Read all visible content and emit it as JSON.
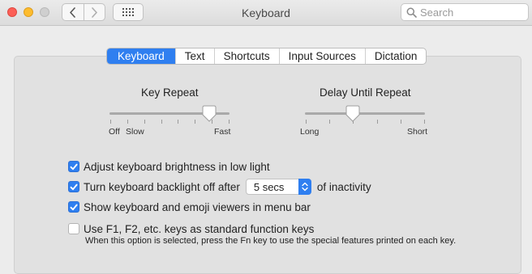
{
  "window": {
    "title": "Keyboard"
  },
  "search": {
    "placeholder": "Search"
  },
  "tabs": [
    {
      "label": "Keyboard",
      "active": true
    },
    {
      "label": "Text",
      "active": false
    },
    {
      "label": "Shortcuts",
      "active": false
    },
    {
      "label": "Input Sources",
      "active": false
    },
    {
      "label": "Dictation",
      "active": false
    }
  ],
  "key_repeat": {
    "label": "Key Repeat",
    "min_label": "Off",
    "slow_label": "Slow",
    "max_label": "Fast",
    "value_fraction": 0.83,
    "tick_count": 8
  },
  "delay_until_repeat": {
    "label": "Delay Until Repeat",
    "min_label": "Long",
    "max_label": "Short",
    "value_fraction": 0.4,
    "tick_count": 6
  },
  "options": {
    "adjust_brightness": {
      "label": "Adjust keyboard brightness in low light",
      "checked": true
    },
    "backlight_off": {
      "label_before": "Turn keyboard backlight off after",
      "select_value": "5 secs",
      "label_after": "of inactivity",
      "checked": true
    },
    "show_viewers": {
      "label": "Show keyboard and emoji viewers in menu bar",
      "checked": true
    },
    "function_keys": {
      "label": "Use F1, F2, etc. keys as standard function keys",
      "checked": false,
      "note": "When this option is selected, press the Fn key to use the special features printed on each key."
    }
  },
  "colors": {
    "accent": "#2f7ff0",
    "window_bg": "#ececec",
    "panel_bg": "#e1e1e1"
  },
  "icons": {
    "close": "close-icon",
    "minimize": "minimize-icon",
    "zoom": "zoom-icon",
    "back": "chevron-left-icon",
    "forward": "chevron-right-icon",
    "grid": "grid-icon",
    "search": "search-icon"
  }
}
